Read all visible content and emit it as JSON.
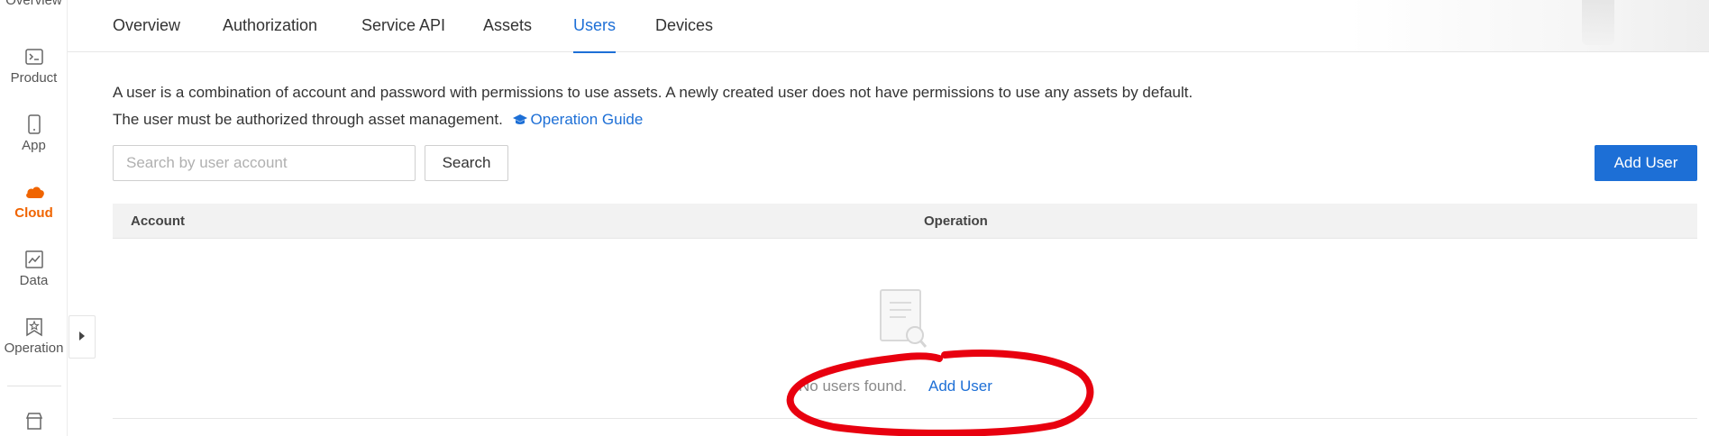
{
  "rail": {
    "items": [
      {
        "label": "Overview",
        "icon": "overview-icon"
      },
      {
        "label": "Product",
        "icon": "terminal-icon"
      },
      {
        "label": "App",
        "icon": "phone-icon"
      },
      {
        "label": "Cloud",
        "icon": "cloud-icon",
        "active": true
      },
      {
        "label": "Data",
        "icon": "chart-icon"
      },
      {
        "label": "Operation",
        "icon": "badge-star-icon"
      }
    ],
    "accent_color": "#f06400"
  },
  "tabs": [
    {
      "label": "Overview"
    },
    {
      "label": "Authorization"
    },
    {
      "label": "Service API"
    },
    {
      "label": "Assets"
    },
    {
      "label": "Users",
      "active": true
    },
    {
      "label": "Devices"
    }
  ],
  "description": {
    "line1": "A user is a combination of account and password with permissions to use assets. A newly created user does not have permissions to use any assets by default.",
    "line2": "The user must be authorized through asset management.",
    "guide_link": "Operation Guide"
  },
  "search": {
    "placeholder": "Search by user account",
    "value": "",
    "button_label": "Search"
  },
  "toolbar": {
    "add_user_label": "Add User"
  },
  "table": {
    "columns": [
      "Account",
      "Operation"
    ],
    "rows": [],
    "empty_text": "No users found.",
    "empty_action": "Add User"
  },
  "colors": {
    "primary": "#1d6fd6",
    "annotation": "#e8000f"
  }
}
